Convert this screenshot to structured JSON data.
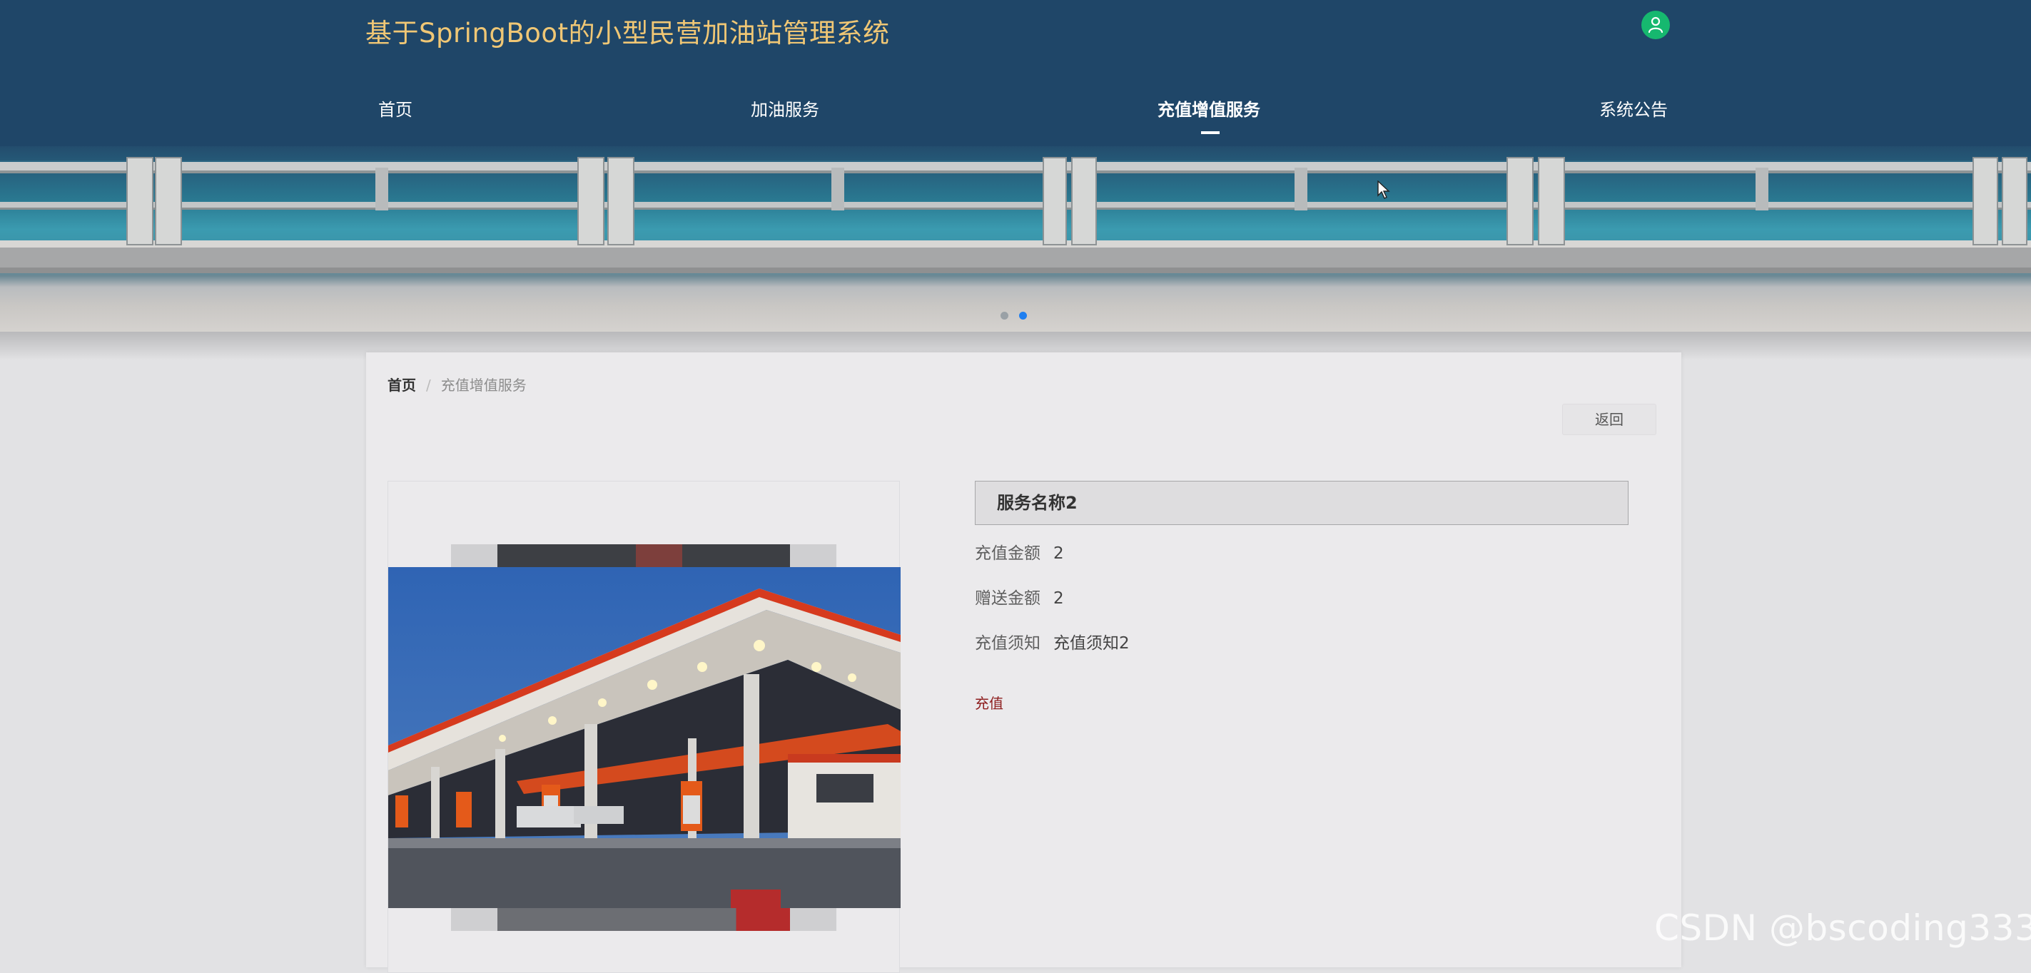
{
  "header": {
    "site_title": "基于SpringBoot的小型民营加油站管理系统",
    "user_icon": "user-icon",
    "title_color": "#f0c775",
    "background_color": "#1f4668"
  },
  "nav": {
    "items": [
      {
        "label": "首页"
      },
      {
        "label": "加油服务"
      },
      {
        "label": "充值增值服务",
        "active": true
      },
      {
        "label": "系统公告"
      }
    ]
  },
  "carousel": {
    "slide_count": 2,
    "active_index": 1,
    "active_dot_color": "#1f7ff0"
  },
  "breadcrumb": {
    "home": "首页",
    "separator": "/",
    "current": "充值增值服务"
  },
  "actions": {
    "back_label": "返回",
    "recharge_label": "充值"
  },
  "service": {
    "name": "服务名称2",
    "fields": [
      {
        "label": "充值金额",
        "value": "2"
      },
      {
        "label": "赠送金额",
        "value": "2"
      },
      {
        "label": "充值须知",
        "value": "充值须知2"
      }
    ]
  },
  "watermark": "CSDN @bscoding333"
}
